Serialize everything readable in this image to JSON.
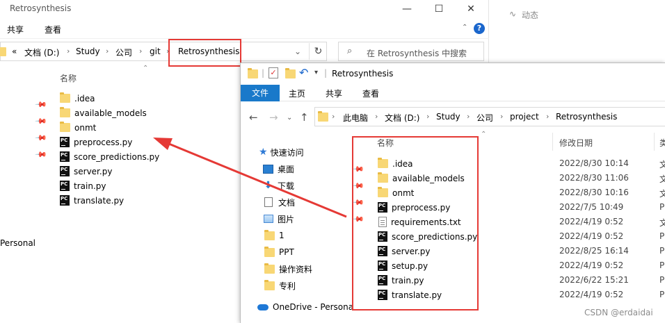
{
  "back_window": {
    "title": "Retrosynthesis",
    "window_controls": {
      "minimize": "—",
      "maximize": "☐",
      "close": "✕"
    },
    "ribbon_tabs": [
      "共享",
      "查看"
    ],
    "help_glyph": "?",
    "breadcrumb": {
      "overflow": "«",
      "items": [
        "文档 (D:)",
        "Study",
        "公司",
        "git",
        "Retrosynthesis"
      ]
    },
    "search_placeholder": "在 Retrosynthesis 中搜索",
    "column_name": "名称",
    "files": [
      {
        "name": ".idea",
        "icon": "folder-icon"
      },
      {
        "name": "available_models",
        "icon": "folder-icon"
      },
      {
        "name": "onmt",
        "icon": "folder-icon"
      },
      {
        "name": "preprocess.py",
        "icon": "pycharm-file-icon"
      },
      {
        "name": "score_predictions.py",
        "icon": "pycharm-file-icon"
      },
      {
        "name": "server.py",
        "icon": "pycharm-file-icon"
      },
      {
        "name": "train.py",
        "icon": "pycharm-file-icon"
      },
      {
        "name": "translate.py",
        "icon": "pycharm-file-icon"
      }
    ],
    "nav_label": "Personal"
  },
  "side_panel": {
    "activity_label": "动态"
  },
  "front_window": {
    "title": "Retrosynthesis",
    "ribbon": {
      "file_tab": "文件",
      "tabs": [
        "主页",
        "共享",
        "查看"
      ]
    },
    "breadcrumb": [
      "此电脑",
      "文档 (D:)",
      "Study",
      "公司",
      "project",
      "Retrosynthesis"
    ],
    "columns": {
      "name": "名称",
      "modified": "修改日期",
      "type": "类"
    },
    "nav_pane": [
      {
        "label": "快速访问",
        "icon": "star-icon"
      },
      {
        "label": "桌面",
        "icon": "desktop-icon"
      },
      {
        "label": "下载",
        "icon": "download-icon"
      },
      {
        "label": "文档",
        "icon": "document-icon"
      },
      {
        "label": "图片",
        "icon": "pictures-icon"
      },
      {
        "label": "1",
        "icon": "folder-icon"
      },
      {
        "label": "PPT",
        "icon": "folder-icon"
      },
      {
        "label": "操作资料",
        "icon": "folder-icon"
      },
      {
        "label": "专利",
        "icon": "folder-icon"
      },
      {
        "label": "OneDrive - Persona",
        "icon": "onedrive-icon"
      }
    ],
    "files": [
      {
        "name": ".idea",
        "date": "2022/8/30 10:14",
        "type": "文",
        "icon": "folder-icon"
      },
      {
        "name": "available_models",
        "date": "2022/8/30 11:06",
        "type": "文",
        "icon": "folder-icon"
      },
      {
        "name": "onmt",
        "date": "2022/8/30 10:16",
        "type": "文",
        "icon": "folder-icon"
      },
      {
        "name": "preprocess.py",
        "date": "2022/7/5 10:49",
        "type": "P'",
        "icon": "pycharm-file-icon"
      },
      {
        "name": "requirements.txt",
        "date": "2022/4/19 0:52",
        "type": "文",
        "icon": "text-file-icon"
      },
      {
        "name": "score_predictions.py",
        "date": "2022/4/19 0:52",
        "type": "P'",
        "icon": "pycharm-file-icon"
      },
      {
        "name": "server.py",
        "date": "2022/8/25 16:14",
        "type": "P'",
        "icon": "pycharm-file-icon"
      },
      {
        "name": "setup.py",
        "date": "2022/4/19 0:52",
        "type": "P'",
        "icon": "pycharm-file-icon"
      },
      {
        "name": "train.py",
        "date": "2022/6/22 15:21",
        "type": "P'",
        "icon": "pycharm-file-icon"
      },
      {
        "name": "translate.py",
        "date": "2022/4/19 0:52",
        "type": "P'",
        "icon": "pycharm-file-icon"
      }
    ]
  },
  "watermark": "CSDN @erdaidai",
  "colors": {
    "annotation_red": "#e53935",
    "file_tab_blue": "#1979ca",
    "folder_yellow": "#f8d775"
  }
}
